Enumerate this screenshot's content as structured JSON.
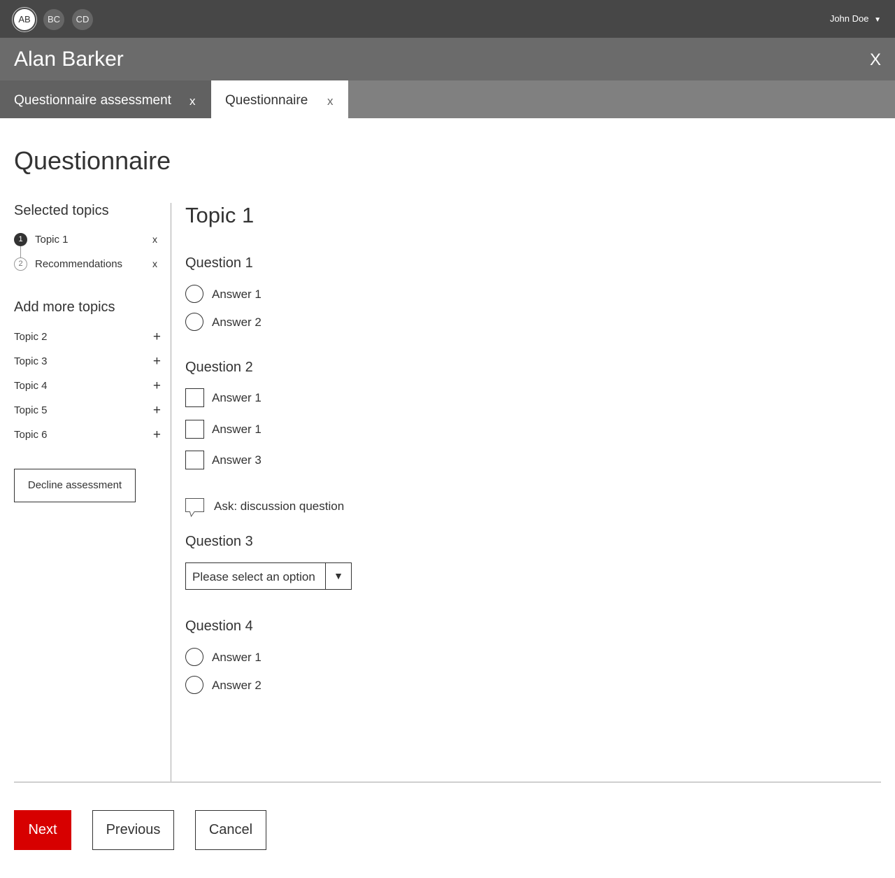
{
  "topbar": {
    "avatars": [
      "AB",
      "BC",
      "CD"
    ],
    "user_name": "John Doe",
    "user_caret": "▼"
  },
  "person_header": {
    "name": "Alan Barker",
    "close_label": "X"
  },
  "tabs": [
    {
      "label": "Questionnaire assessment",
      "close": "x"
    },
    {
      "label": "Questionnaire",
      "close": "x"
    }
  ],
  "page_title": "Questionnaire",
  "sidebar": {
    "selected_title": "Selected topics",
    "selected_topics": [
      {
        "number": "1",
        "label": "Topic 1",
        "remove": "x"
      },
      {
        "number": "2",
        "label": "Recommendations",
        "remove": "x"
      }
    ],
    "add_title": "Add more topics",
    "add_topics": [
      {
        "label": "Topic 2",
        "icon": "+"
      },
      {
        "label": "Topic 3",
        "icon": "+"
      },
      {
        "label": "Topic 4",
        "icon": "+"
      },
      {
        "label": "Topic 5",
        "icon": "+"
      },
      {
        "label": "Topic 6",
        "icon": "+"
      }
    ],
    "decline_label": "Decline assessment"
  },
  "main": {
    "topic_title": "Topic 1",
    "q1": {
      "title": "Question 1",
      "options": [
        "Answer 1",
        "Answer 2"
      ]
    },
    "q2": {
      "title": "Question 2",
      "options": [
        "Answer 1",
        "Answer 1",
        "Answer 3"
      ]
    },
    "discussion_label": "Ask: discussion question",
    "q3": {
      "title": "Question 3",
      "placeholder": "Please select an option",
      "caret": "▼"
    },
    "q4": {
      "title": "Question 4",
      "options": [
        "Answer 1",
        "Answer 2"
      ]
    }
  },
  "footer": {
    "next_label": "Next",
    "previous_label": "Previous",
    "cancel_label": "Cancel"
  },
  "colors": {
    "topbar": "#474747",
    "person_header": "#6b6b6b",
    "tabbar": "#808080",
    "active_step": "#333333",
    "primary_button": "#d70000"
  }
}
